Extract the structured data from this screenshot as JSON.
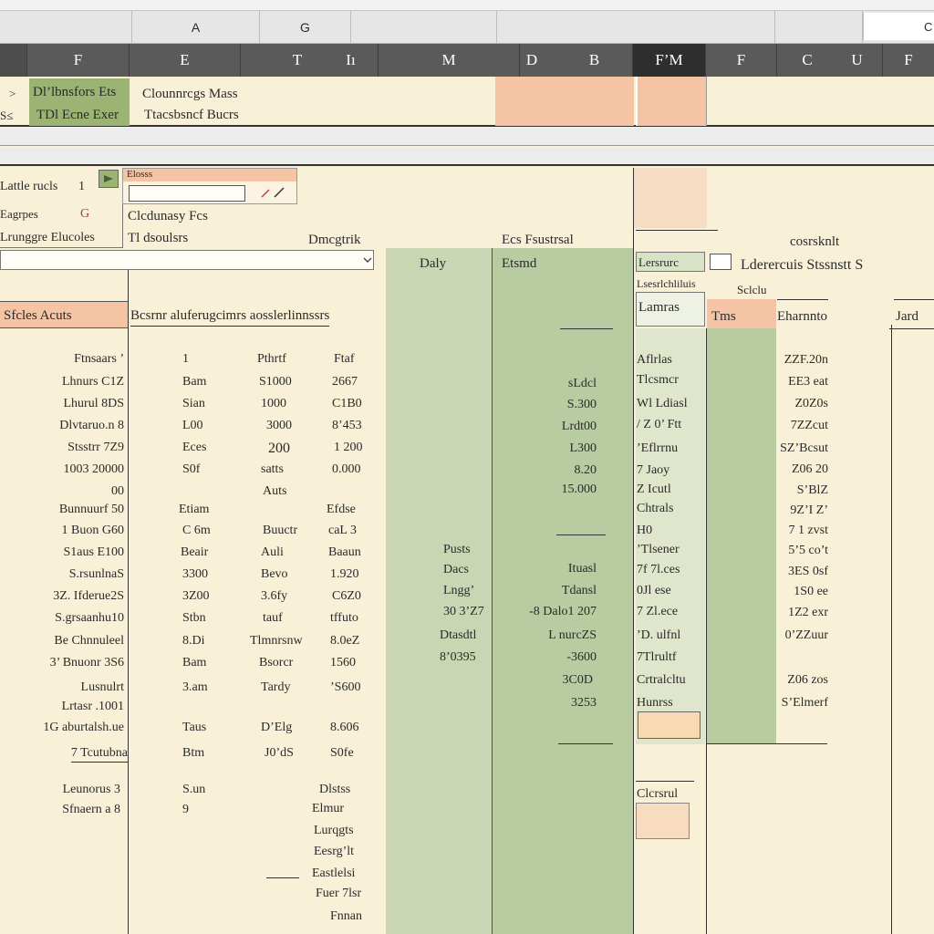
{
  "column_bar": {
    "letters": [
      {
        "label": "A"
      },
      {
        "label": "G"
      },
      {
        "label": "C"
      }
    ]
  },
  "header_row": {
    "cells": [
      "F",
      "E",
      "T",
      "Iı",
      "M",
      "D",
      "B",
      "F’M",
      "F",
      "C",
      "U",
      "F"
    ]
  },
  "info_band": {
    "row_markers": [
      ">",
      "S≤"
    ],
    "green_lines": [
      "Dl’lbnsfors Ets",
      "TDl Ecne Exer"
    ],
    "mid_lines": [
      "Clounnrcgs  Mass",
      "Ttacsbsncf  Bucrs"
    ]
  },
  "form_panel": {
    "row_labels": [
      "Lattle rucls",
      "Eagrpes",
      "Lrunggre Elucoles"
    ],
    "row_values": [
      "1",
      "G"
    ],
    "top_caption": "Elosss",
    "input_value": "",
    "lines": [
      "Clcdunasy  Fcs",
      "Tl dsoulsrs"
    ]
  },
  "section_headers": {
    "search_bar_value": "",
    "left_title": "Sfcles Acuts",
    "left_caption": "Bcsrnr aluferugcimrs aosslerlinnssrs",
    "col_heading_1": "Dmcgtrik",
    "col_heading_2": "Ecs Fsustrsal",
    "date_label": "Daly",
    "ext_label": "Etsmd",
    "right_top": "Lersrurc",
    "right_sub": "Lsesrlchliluis",
    "right_box": "Lamras",
    "right_group": "Lderercuis Stssnstt S",
    "right_group_top": "cosrsknlt",
    "right_small": "Sclclu",
    "right_col_a": "Tms",
    "right_col_b": "Eharnnto",
    "far_right": "Jard"
  },
  "table_left": {
    "rows": [
      {
        "name": "Ftnsaars ’",
        "c1": "1",
        "c2": "Pthrtf",
        "c3": "Ftaf"
      },
      {
        "name": "Lhnurs C1Z",
        "c1": "Bam",
        "c2": "S1000",
        "c3": "2667"
      },
      {
        "name": "Lhurul 8DS",
        "c1": "Sian",
        "c2": "1000",
        "c3": "C1B0"
      },
      {
        "name": "Dlvtaruo.n 8",
        "c1": "L00",
        "c2": "3000",
        "c3": "8’453"
      },
      {
        "name": "Stsstrr 7Z9",
        "c1": "Eces",
        "c2": "200",
        "c3": "1 200"
      },
      {
        "name": "1003 20000",
        "c1": "S0f",
        "c2": "satts",
        "c3": "0.000"
      },
      {
        "name": "00",
        "c1": "",
        "c2": "Auts",
        "c3": ""
      },
      {
        "name": "Bunnuurf 50",
        "c1": "Etiam",
        "c2": "",
        "c3": "Efdse"
      },
      {
        "name": "1 Buon G60",
        "c1": "C 6m",
        "c2": "Buuctr",
        "c3": "caL 3"
      },
      {
        "name": "S1aus E100",
        "c1": "Beair",
        "c2": "Auli",
        "c3": "Baaun"
      },
      {
        "name": "S.rsunlnaS",
        "c1": "3300",
        "c2": "Bevo",
        "c3": "1.920"
      },
      {
        "name": "3Z. Ifderue2S",
        "c1": "3Z00",
        "c2": "3.6fy",
        "c3": "C6Z0"
      },
      {
        "name": "S.grsaanhu10",
        "c1": "Stbn",
        "c2": "tauf",
        "c3": "tffuto"
      },
      {
        "name": "Be Chnnuleel",
        "c1": "8.Di",
        "c2": "Tlmnrsnw",
        "c3": "8.0eZ"
      },
      {
        "name": "3’ Bnuonr 3S6",
        "c1": "Bam",
        "c2": "Bsorcr",
        "c3": "1560"
      },
      {
        "name": "Lusnulrt",
        "c1": "3.am",
        "c2": "Tardy",
        "c3": "’S600"
      },
      {
        "name": "Lrtasr .1001",
        "c1": "",
        "c2": "",
        "c3": ""
      },
      {
        "name": "1G aburtalsh.ue",
        "c1": "Taus",
        "c2": "D’Elg",
        "c3": "8.606"
      },
      {
        "name": "7  Tcutubna",
        "c1": "Btm",
        "c2": "J0’dS",
        "c3": "S0fe"
      }
    ],
    "footer_rows": [
      {
        "name": "Leunorus 3",
        "c1": "S.un"
      },
      {
        "name": "Sfnaern a 8",
        "c1": "9"
      }
    ],
    "footer_notes": [
      "Dlstss",
      "Elmur",
      "Lurqgts",
      "Eesrg’lt",
      "Eastlelsi",
      "Fuer 7lsr",
      "Fnnan"
    ]
  },
  "table_mid": {
    "rows": [
      "sLdcl",
      "S.300",
      "Lrdt00",
      "L300",
      "8.20",
      "15.000",
      "",
      "",
      "Ituasl",
      "Tdansl",
      "-8  Dalo1 207",
      "L  nurcZS",
      "-3600",
      "3C0D",
      "3253"
    ],
    "date_rows": [
      "Pusts",
      "Dacs",
      "Lngg’",
      "30 3’Z7",
      "Dtasdtl",
      "8’0395"
    ]
  },
  "table_right": {
    "rows": [
      "Aflrlas",
      "Tlcsmcr",
      "Wl Ldiasl",
      "/ Z 0’ Ftt",
      "’Eflrrnu",
      "7 Jaoy",
      "Z  Icutl",
      "Chtrals",
      "H0",
      "’Tlsener",
      "7f 7l.ces",
      "0Jl ese",
      "7 Zl.ece",
      "’D. ulfnl",
      "7Tlrultf",
      "Crtralcltu",
      "Hunrss"
    ],
    "right_values": [
      "ZZF.20n",
      "EE3 eat",
      "Z0Z0s",
      "7ZZcut",
      "SZ’Bcsut",
      "Z06 20",
      "S’BlZ",
      "9Z’I Z’",
      "7 1 zvst",
      "5’5 co’t",
      "3ES 0sf",
      "1S0 ee",
      "1Z2 exr",
      "0’ZZuur",
      "Z06 zos",
      "S’Elmerf"
    ],
    "bottom_label": "Clcrsrul"
  },
  "colors": {
    "background": "#f9f0d8",
    "header_dark": "#5a5a5a",
    "green_accent": "#9bb373",
    "peach_accent": "#f4c4a4",
    "pale_green": "#c9d6b4",
    "active_header": "#2e2e2e"
  }
}
